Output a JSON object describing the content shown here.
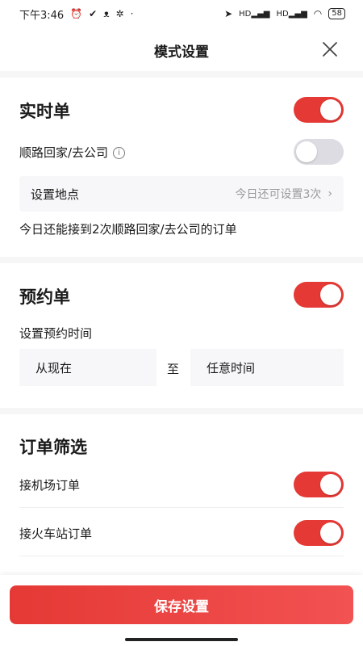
{
  "status_bar": {
    "time": "下午3:46",
    "battery": "58",
    "network_1": "HD",
    "network_2": "HD"
  },
  "header": {
    "title": "模式设置"
  },
  "realtime": {
    "title": "实时单",
    "enabled": true,
    "home_office_label": "顺路回家/去公司",
    "home_office_enabled": false,
    "location_label": "设置地点",
    "location_hint": "今日还可设置3次",
    "note": "今日还能接到2次顺路回家/去公司的订单"
  },
  "reservation": {
    "title": "预约单",
    "enabled": true,
    "time_label": "设置预约时间",
    "from_value": "从现在",
    "to_word": "至",
    "to_value": "任意时间"
  },
  "filter": {
    "title": "订单筛选",
    "items": [
      {
        "label": "接机场订单",
        "enabled": true
      },
      {
        "label": "接火车站订单",
        "enabled": true
      }
    ]
  },
  "footer": {
    "save_label": "保存设置"
  },
  "colors": {
    "accent": "#e53935",
    "toggle_off": "#dcdce2",
    "row_bg": "#f7f7f9"
  }
}
